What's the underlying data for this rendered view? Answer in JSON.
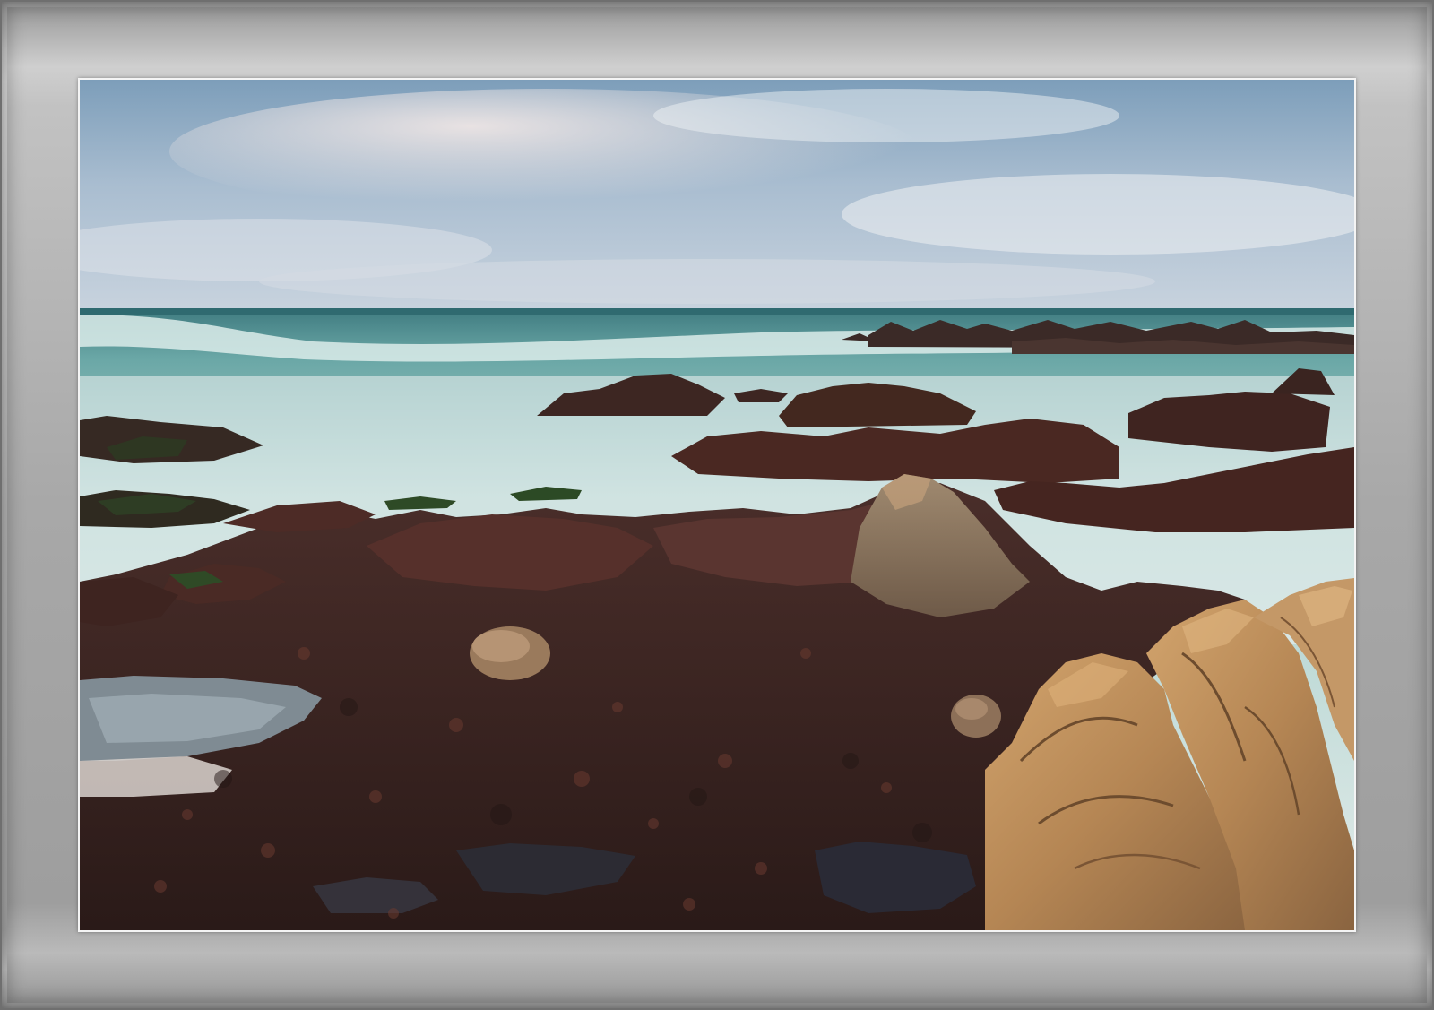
{
  "scene": {
    "subject": "rocky-coastline-long-exposure",
    "colors": {
      "frame": "#a9a9a9",
      "mat": "#f4f4f4",
      "sky_top": "#7fa0bd",
      "sky_bottom": "#c9d5e0",
      "sea": "#7fb7b2",
      "mist": "#e6eceb",
      "seaweed_rock": "#3a2520",
      "granite": "#b98a55"
    }
  }
}
